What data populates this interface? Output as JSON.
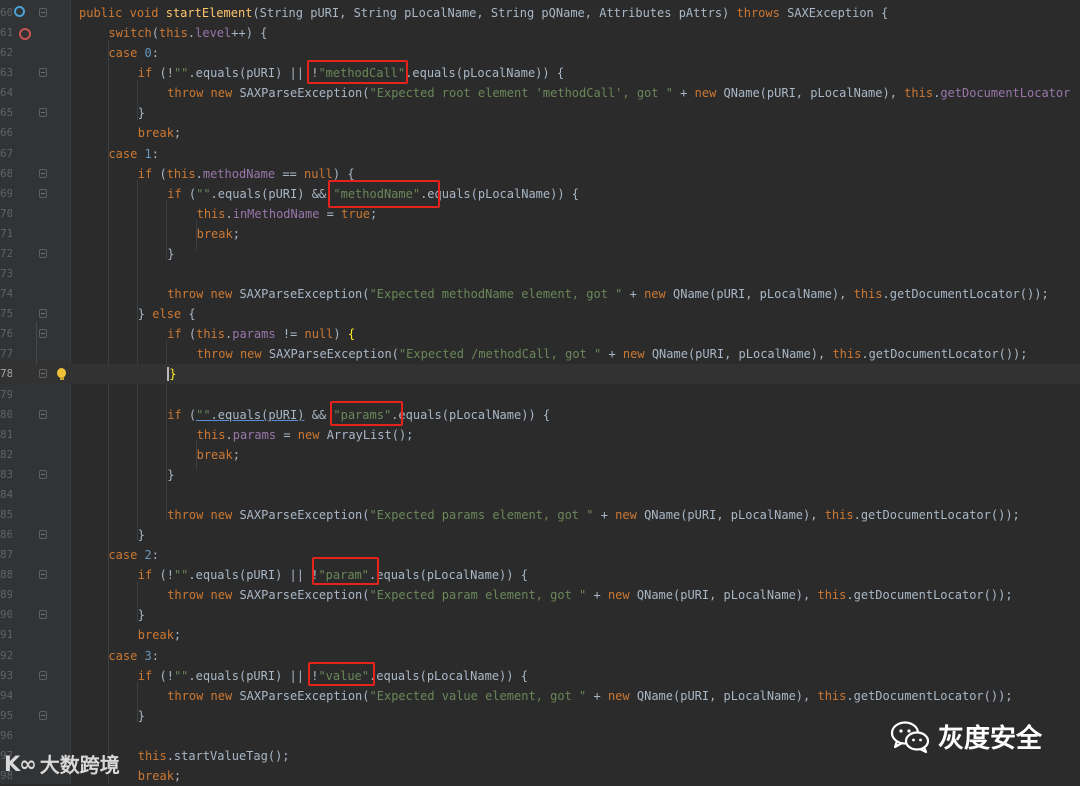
{
  "editor": {
    "lines": [
      {
        "num": "60",
        "text": "public void startElement(String pURI, String pLocalName, String pQName, Attributes pAttrs) throws SAXException {"
      },
      {
        "num": "61",
        "text": "switch(this.level++) {"
      },
      {
        "num": "62",
        "text": "case 0:"
      },
      {
        "num": "63",
        "text": "if (!\"\".equals(pURI) || !\"methodCall\".equals(pLocalName)) {"
      },
      {
        "num": "64",
        "text": "throw new SAXParseException(\"Expected root element 'methodCall', got \" + new QName(pURI, pLocalName), this.getDocumentLocator"
      },
      {
        "num": "65",
        "text": "}"
      },
      {
        "num": "66",
        "text": "break;"
      },
      {
        "num": "67",
        "text": "case 1:"
      },
      {
        "num": "68",
        "text": "if (this.methodName == null) {"
      },
      {
        "num": "69",
        "text": "if (\"\".equals(pURI) && \"methodName\".equals(pLocalName)) {"
      },
      {
        "num": "70",
        "text": "this.inMethodName = true;"
      },
      {
        "num": "71",
        "text": "break;"
      },
      {
        "num": "72",
        "text": "}"
      },
      {
        "num": "73",
        "text": ""
      },
      {
        "num": "74",
        "text": "throw new SAXParseException(\"Expected methodName element, got \" + new QName(pURI, pLocalName), this.getDocumentLocator());"
      },
      {
        "num": "75",
        "text": "} else {"
      },
      {
        "num": "76",
        "text": "if (this.params != null) {"
      },
      {
        "num": "77",
        "text": "throw new SAXParseException(\"Expected /methodCall, got \" + new QName(pURI, pLocalName), this.getDocumentLocator());"
      },
      {
        "num": "78",
        "text": "}"
      },
      {
        "num": "79",
        "text": ""
      },
      {
        "num": "80",
        "text": "if (\"\".equals(pURI) && \"params\".equals(pLocalName)) {"
      },
      {
        "num": "81",
        "text": "this.params = new ArrayList();"
      },
      {
        "num": "82",
        "text": "break;"
      },
      {
        "num": "83",
        "text": "}"
      },
      {
        "num": "84",
        "text": ""
      },
      {
        "num": "85",
        "text": "throw new SAXParseException(\"Expected params element, got \" + new QName(pURI, pLocalName), this.getDocumentLocator());"
      },
      {
        "num": "86",
        "text": "}"
      },
      {
        "num": "87",
        "text": "case 2:"
      },
      {
        "num": "88",
        "text": "if (!\"\".equals(pURI) || !\"param\".equals(pLocalName)) {"
      },
      {
        "num": "89",
        "text": "throw new SAXParseException(\"Expected param element, got \" + new QName(pURI, pLocalName), this.getDocumentLocator());"
      },
      {
        "num": "90",
        "text": "}"
      },
      {
        "num": "91",
        "text": "break;"
      },
      {
        "num": "92",
        "text": "case 3:"
      },
      {
        "num": "93",
        "text": "if (!\"\".equals(pURI) || !\"value\".equals(pLocalName)) {"
      },
      {
        "num": "94",
        "text": "throw new SAXParseException(\"Expected value element, got \" + new QName(pURI, pLocalName), this.getDocumentLocator());"
      },
      {
        "num": "95",
        "text": "}"
      },
      {
        "num": "96",
        "text": ""
      },
      {
        "num": "97",
        "text": "this.startValueTag();"
      },
      {
        "num": "98",
        "text": "break;"
      }
    ]
  },
  "watermarks": {
    "left_logo": "K∞",
    "left_text": "大数跨境",
    "right_icon": "wechat-icon",
    "right_text": "灰度安全"
  },
  "colors": {
    "background": "#2b2b2b",
    "keyword": "#cc7832",
    "string": "#6a8759",
    "field": "#9876aa",
    "highlight_box": "#e4231d"
  }
}
